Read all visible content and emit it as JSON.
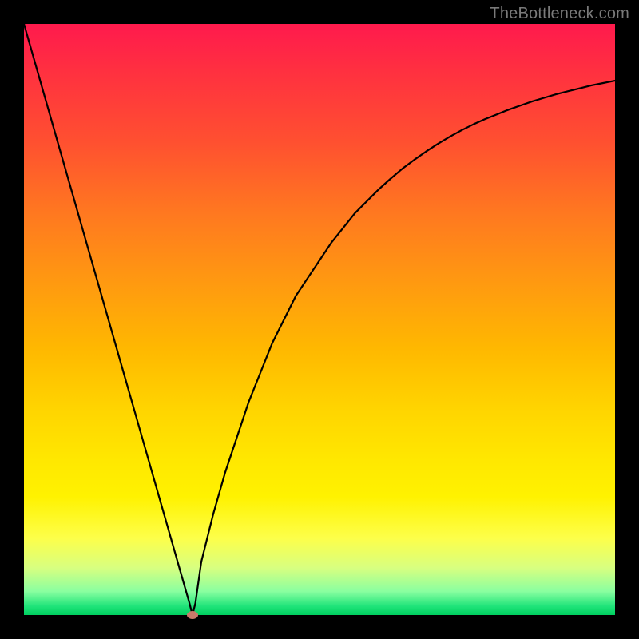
{
  "watermark": "TheBottleneck.com",
  "colors": {
    "background": "#000000",
    "curve_stroke": "#000000",
    "marker_fill": "#c97a6a",
    "gradient_top": "#ff1a4d",
    "gradient_bottom": "#00d060"
  },
  "chart_data": {
    "type": "line",
    "title": "",
    "xlabel": "",
    "ylabel": "",
    "xlim": [
      0,
      100
    ],
    "ylim": [
      0,
      100
    ],
    "grid": false,
    "legend": false,
    "x": [
      0,
      2,
      4,
      6,
      8,
      10,
      12,
      14,
      16,
      18,
      20,
      22,
      24,
      26,
      28,
      28.5,
      29,
      30,
      32,
      34,
      36,
      38,
      40,
      42,
      44,
      46,
      48,
      50,
      52,
      54,
      56,
      58,
      60,
      62,
      64,
      66,
      68,
      70,
      72,
      74,
      76,
      78,
      80,
      82,
      84,
      86,
      88,
      90,
      92,
      94,
      96,
      98,
      100
    ],
    "values": [
      100,
      93,
      86,
      79,
      72,
      65,
      58,
      51,
      44,
      37,
      30,
      23,
      16,
      9,
      2,
      0,
      2,
      9,
      17,
      24,
      30,
      36,
      41,
      46,
      50,
      54,
      57,
      60,
      63,
      65.5,
      68,
      70,
      72,
      73.8,
      75.5,
      77,
      78.4,
      79.7,
      80.9,
      82,
      83,
      83.9,
      84.7,
      85.5,
      86.2,
      86.9,
      87.5,
      88.1,
      88.6,
      89.1,
      89.6,
      90,
      90.4
    ],
    "minimum_point": {
      "x": 28.5,
      "y": 0
    },
    "annotations": []
  }
}
